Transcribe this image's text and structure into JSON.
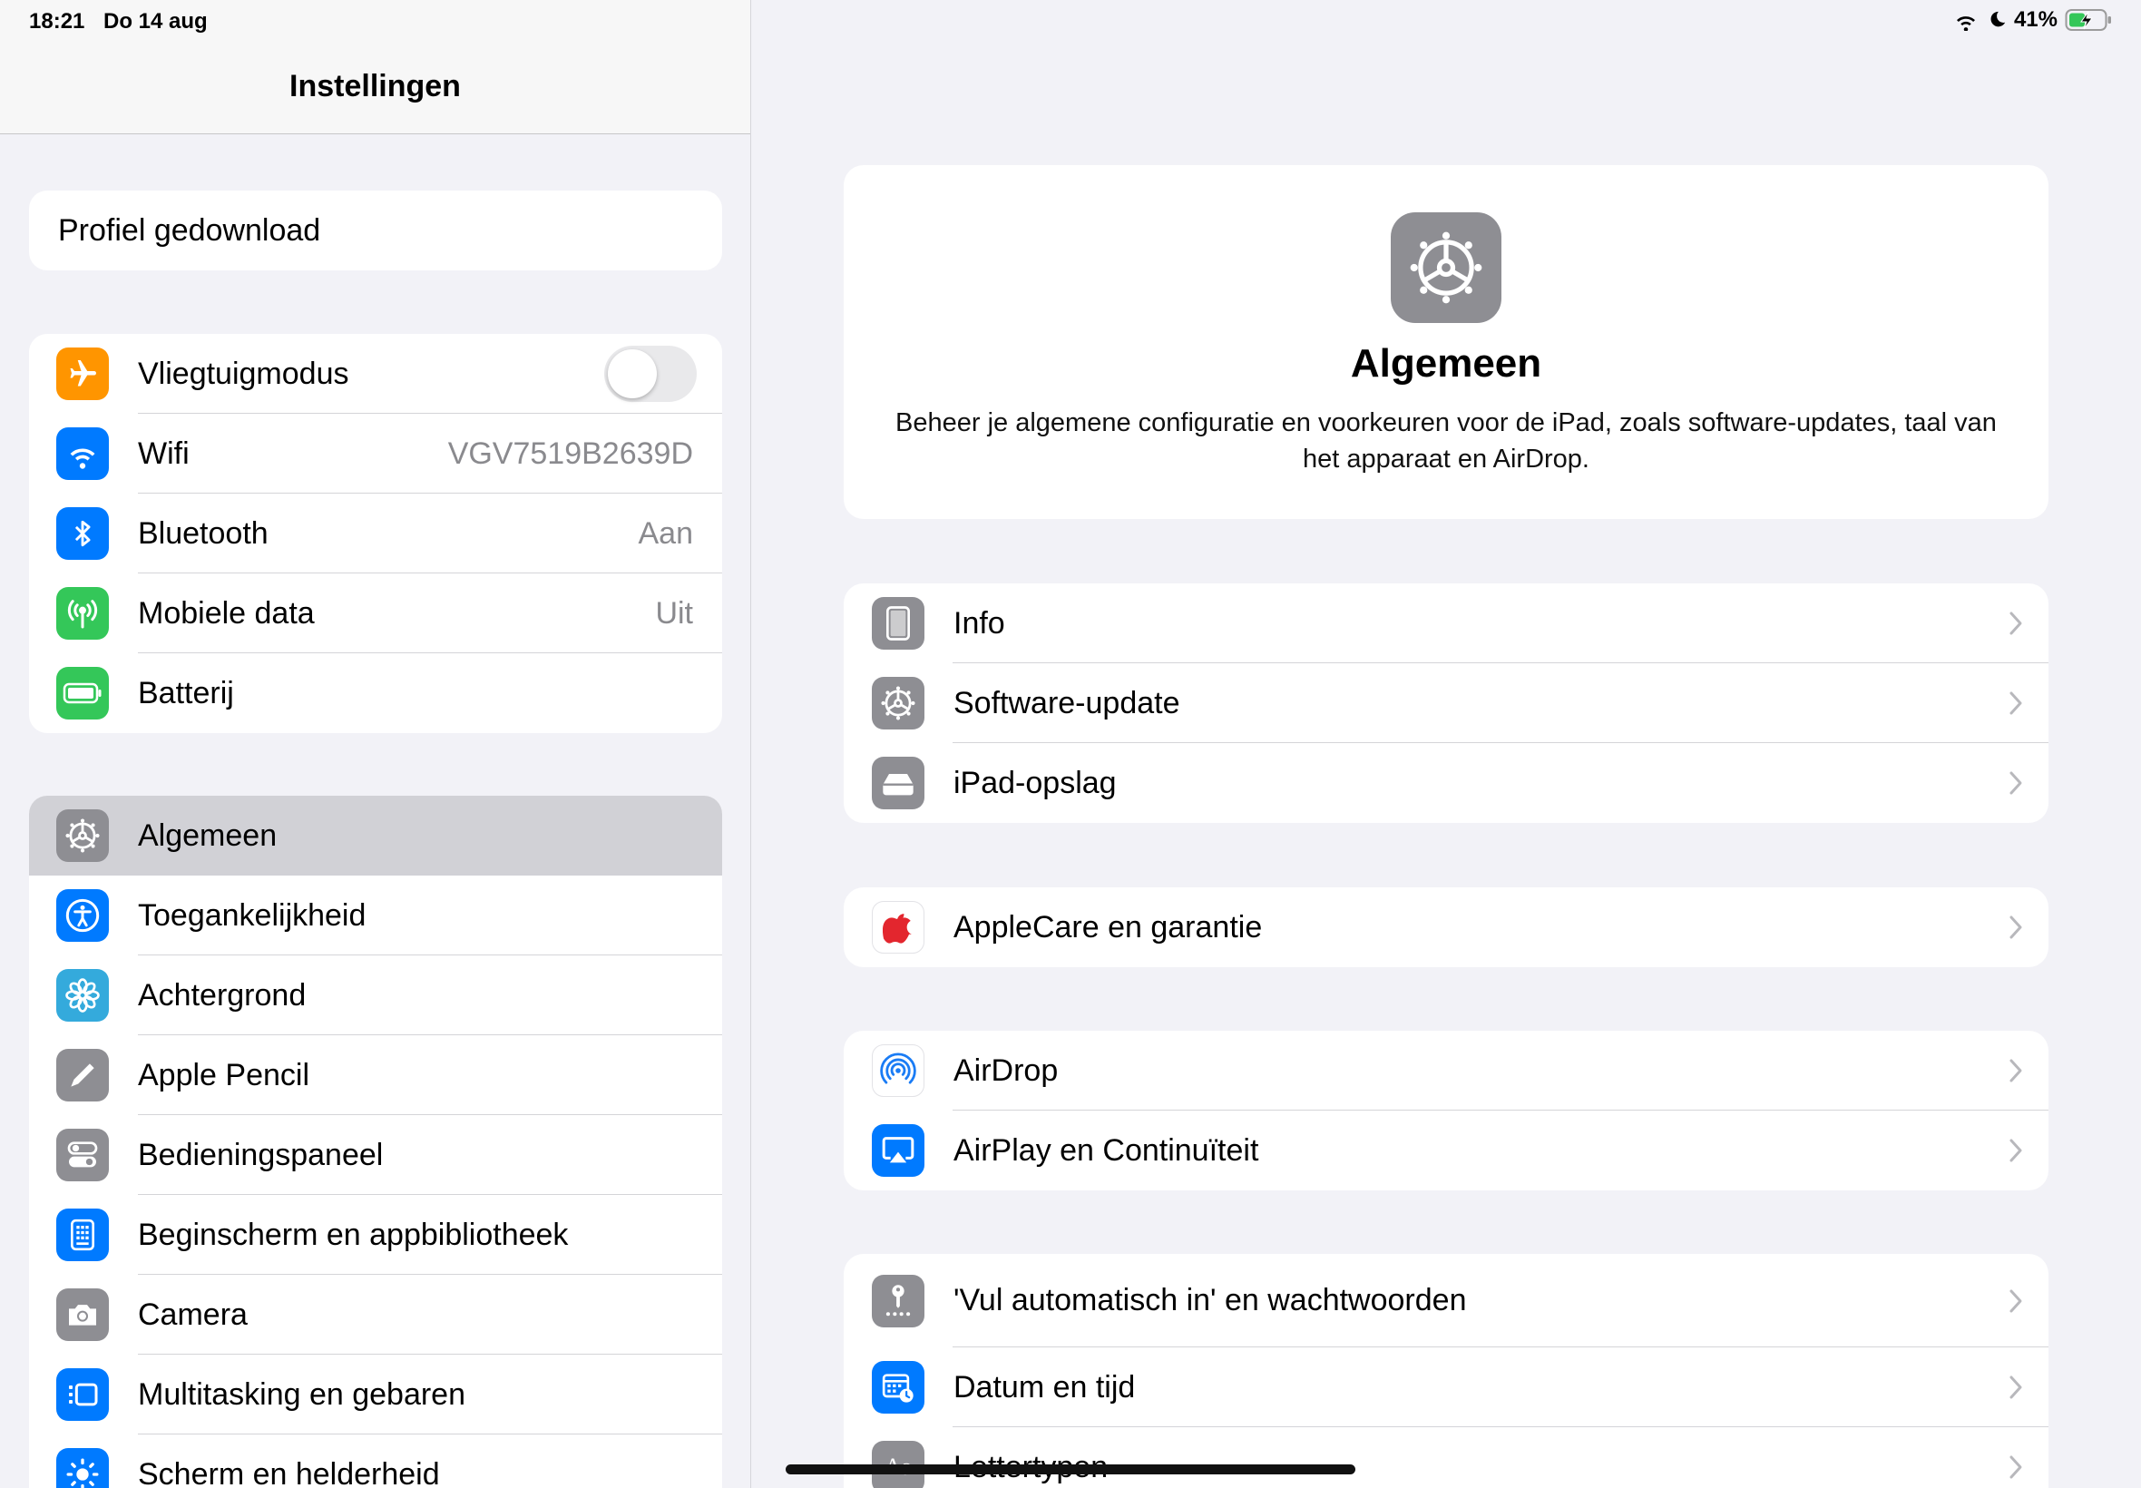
{
  "status_bar": {
    "time": "18:21",
    "date": "Do 14 aug",
    "battery": "41%"
  },
  "sidebar": {
    "title": "Instellingen",
    "profile_label": "Profiel gedownload",
    "connectivity": [
      {
        "label": "Vliegtuigmodus",
        "icon": "airplane-icon",
        "color": "#ff9500",
        "toggle": false
      },
      {
        "label": "Wifi",
        "value": "VGV7519B2639D",
        "icon": "wifi-icon",
        "color": "#007aff"
      },
      {
        "label": "Bluetooth",
        "value": "Aan",
        "icon": "bluetooth-icon",
        "color": "#007aff"
      },
      {
        "label": "Mobiele data",
        "value": "Uit",
        "icon": "antenna-icon",
        "color": "#34c759"
      },
      {
        "label": "Batterij",
        "icon": "battery-icon",
        "color": "#34c759"
      }
    ],
    "general": [
      {
        "label": "Algemeen",
        "icon": "gear-icon",
        "color": "#8e8e93",
        "selected": true
      },
      {
        "label": "Toegankelijkheid",
        "icon": "accessibility-icon",
        "color": "#007aff"
      },
      {
        "label": "Achtergrond",
        "icon": "flower-icon",
        "color": "#34aadc"
      },
      {
        "label": "Apple Pencil",
        "icon": "pencil-icon",
        "color": "#8e8e93"
      },
      {
        "label": "Bedieningspaneel",
        "icon": "switches-icon",
        "color": "#8e8e93"
      },
      {
        "label": "Beginscherm en appbibliotheek",
        "icon": "home-screen-icon",
        "color": "#007aff"
      },
      {
        "label": "Camera",
        "icon": "camera-icon",
        "color": "#8e8e93"
      },
      {
        "label": "Multitasking en gebaren",
        "icon": "multitasking-icon",
        "color": "#007aff"
      },
      {
        "label": "Scherm en helderheid",
        "icon": "sun-icon",
        "color": "#007aff"
      }
    ]
  },
  "detail": {
    "title": "Algemeen",
    "description": "Beheer je algemene configuratie en voorkeuren voor de iPad, zoals software-updates, taal van het apparaat en AirDrop.",
    "group1": [
      {
        "label": "Info",
        "icon": "ipad-icon"
      },
      {
        "label": "Software-update",
        "icon": "gear-update-icon"
      },
      {
        "label": "iPad-opslag",
        "icon": "storage-icon"
      }
    ],
    "group2": [
      {
        "label": "AppleCare en garantie",
        "icon": "apple-logo-icon"
      }
    ],
    "group3": [
      {
        "label": "AirDrop",
        "icon": "airdrop-icon"
      },
      {
        "label": "AirPlay en Continuïteit",
        "icon": "airplay-icon"
      }
    ],
    "group4": [
      {
        "label": "'Vul automatisch in' en wachtwoorden",
        "icon": "key-icon"
      },
      {
        "label": "Datum en tijd",
        "icon": "calendar-clock-icon"
      },
      {
        "label": "Lettertypen",
        "icon": "font-icon"
      }
    ]
  }
}
